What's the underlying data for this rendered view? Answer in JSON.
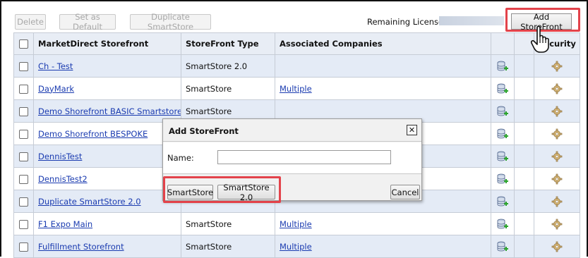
{
  "toolbar": {
    "delete_label": "Delete",
    "set_default_label": "Set as Default",
    "duplicate_label": "Duplicate SmartStore",
    "remaining_licenses_label": "Remaining Licenses:",
    "add_storefront_label": "Add StoreFront"
  },
  "table": {
    "headers": {
      "storefront": "MarketDirect Storefront",
      "type": "StoreFront Type",
      "companies": "Associated Companies",
      "security": "Security"
    },
    "rows": [
      {
        "name": "Ch - Test",
        "type": "SmartStore 2.0",
        "companies": ""
      },
      {
        "name": "DayMark",
        "type": "SmartStore",
        "companies": "Multiple"
      },
      {
        "name": "Demo Shorefront BASIC Smartstore",
        "type": "SmartStore",
        "companies": ""
      },
      {
        "name": "Demo Shorefront BESPOKE",
        "type": "",
        "companies": ""
      },
      {
        "name": "DennisTest",
        "type": "",
        "companies": ""
      },
      {
        "name": "DennisTest2",
        "type": "",
        "companies": ""
      },
      {
        "name": "Duplicate SmartStore 2.0",
        "type": "",
        "companies": ""
      },
      {
        "name": "F1 Expo Main",
        "type": "SmartStore",
        "companies": "Multiple"
      },
      {
        "name": "Fulfillment Storefront",
        "type": "SmartStore",
        "companies": "Multiple"
      }
    ]
  },
  "dialog": {
    "title": "Add StoreFront",
    "close_glyph": "✕",
    "name_label": "Name:",
    "name_value": "",
    "smartstore_label": "SmartStore",
    "smartstore2_label": "SmartStore 2.0",
    "cancel_label": "Cancel"
  },
  "colors": {
    "highlight": "#e3434b",
    "link": "#1a3bb0",
    "row_alt": "#e4ebf6"
  },
  "icons": {
    "database": "database-add-icon",
    "security": "gear-icon",
    "cursor": "hand-pointer-icon"
  }
}
